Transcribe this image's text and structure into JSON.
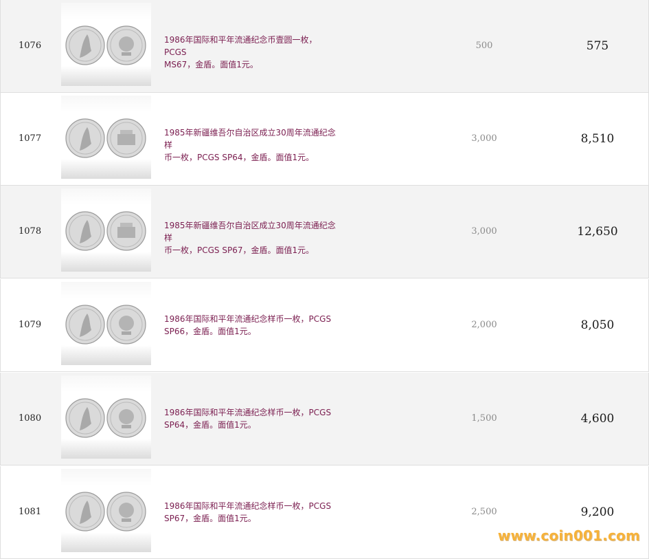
{
  "lots": [
    {
      "lot_no": "1076",
      "description_line1": "1986年国际和平年流通纪念币壹圆一枚，PCGS",
      "description_line2": "MS67，金盾。面值1元。",
      "estimate": "500",
      "price": "575",
      "image_icon": "coin-pair-image"
    },
    {
      "lot_no": "1077",
      "description_line1": "1985年新疆维吾尔自治区成立30周年流通纪念样",
      "description_line2": "币一枚，PCGS SP64，金盾。面值1元。",
      "estimate": "3,000",
      "price": "8,510",
      "image_icon": "coin-pair-image"
    },
    {
      "lot_no": "1078",
      "description_line1": "1985年新疆维吾尔自治区成立30周年流通纪念样",
      "description_line2": "币一枚，PCGS SP67，金盾。面值1元。",
      "estimate": "3,000",
      "price": "12,650",
      "image_icon": "coin-pair-image"
    },
    {
      "lot_no": "1079",
      "description_line1": "1986年国际和平年流通纪念样币一枚，PCGS",
      "description_line2": "SP66，金盾。面值1元。",
      "estimate": "2,000",
      "price": "8,050",
      "image_icon": "coin-pair-image"
    },
    {
      "lot_no": "1080",
      "description_line1": "1986年国际和平年流通纪念样币一枚，PCGS",
      "description_line2": "SP64，金盾。面值1元。",
      "estimate": "1,500",
      "price": "4,600",
      "image_icon": "coin-pair-image"
    },
    {
      "lot_no": "1081",
      "description_line1": "1986年国际和平年流通纪念样币一枚，PCGS",
      "description_line2": "SP67，金盾。面值1元。",
      "estimate": "2,500",
      "price": "9,200",
      "image_icon": "coin-pair-image"
    }
  ],
  "watermark": "www.coin001.com",
  "colors": {
    "description_text": "#7a1d4f",
    "row_alt_bg": "#f3f3f3",
    "row_border": "#dedede",
    "watermark": "#f6b23a"
  }
}
